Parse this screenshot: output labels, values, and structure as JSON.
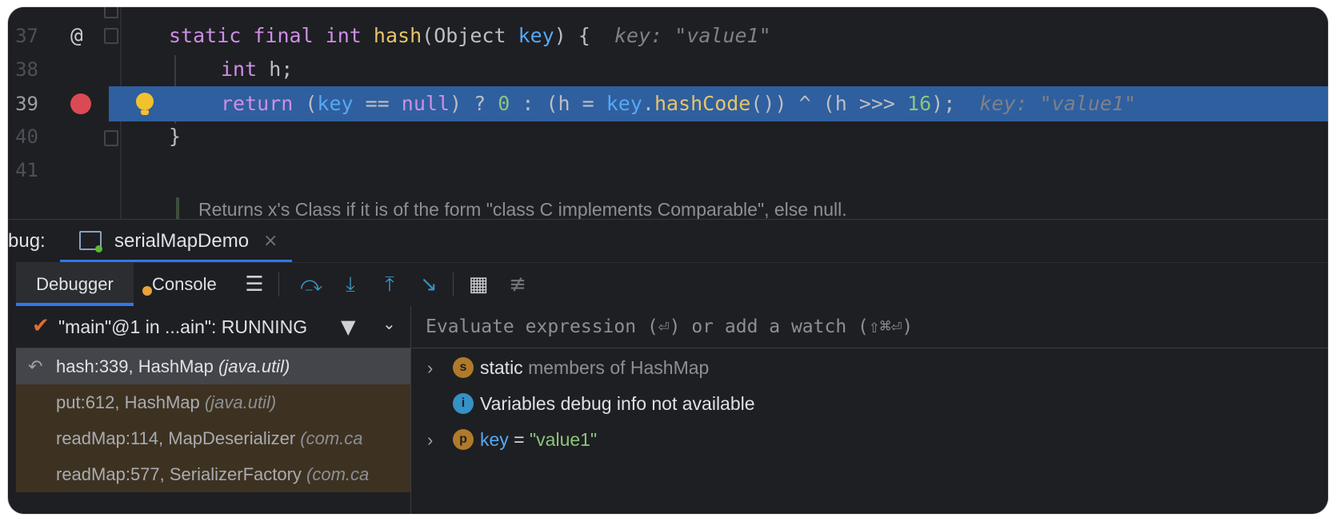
{
  "editor": {
    "lines": [
      {
        "num": "37",
        "gutter": "@"
      },
      {
        "num": "38"
      },
      {
        "num": "39"
      },
      {
        "num": "40"
      },
      {
        "num": "41"
      }
    ],
    "code": {
      "l37": {
        "kw1": "static",
        "kw2": "final",
        "kw3": "int",
        "fn": "hash",
        "p1": "(Object ",
        "arg": "key",
        "p2": ") {",
        "hint": "key: \"value1\""
      },
      "l38": {
        "kw": "int",
        "rest": " h;"
      },
      "l39": {
        "kw": "return",
        "p1": " (",
        "k1": "key",
        "p2": " == ",
        "nul": "null",
        "p3": ") ? ",
        "zero": "0",
        "p4": " : (h = ",
        "k2": "key",
        "dot": ".",
        "meth": "hashCode",
        "p5": "()) ^ (h >>> ",
        "sixteen": "16",
        "p6": ");",
        "hint": "key: \"value1\""
      },
      "l40": {
        "text": "}"
      }
    },
    "doc_text": "Returns x's Class if it is of the form \"class C implements Comparable\", else null."
  },
  "debug_bar": {
    "label": "bug:",
    "run_tab": "serialMapDemo",
    "close": "×"
  },
  "toolbar": {
    "tabs": [
      "Debugger",
      "Console"
    ],
    "icons": [
      "menu-icon",
      "step-over-icon",
      "step-into-icon",
      "step-out-icon",
      "run-to-cursor-icon",
      "evaluate-icon",
      "trace-icon"
    ]
  },
  "frames": {
    "thread": "\"main\"@1 in ...ain\": RUNNING",
    "items": [
      {
        "method": "hash:339, HashMap ",
        "pkg": "(java.util)"
      },
      {
        "method": "put:612, HashMap ",
        "pkg": "(java.util)"
      },
      {
        "method": "readMap:114, MapDeserializer ",
        "pkg": "(com.ca"
      },
      {
        "method": "readMap:577, SerializerFactory ",
        "pkg": "(com.ca"
      }
    ]
  },
  "variables": {
    "eval_placeholder": "Evaluate expression (⏎) or add a watch (⇧⌘⏎)",
    "rows": [
      {
        "badge": "s",
        "label": "static",
        "muted": " members of HashMap"
      },
      {
        "badge": "i",
        "label": "Variables debug info not available"
      },
      {
        "badge": "p",
        "name": "key",
        "eq": " = ",
        "value": "\"value1\""
      }
    ]
  },
  "colors": {
    "highlight_line": "#2f5f9e",
    "accent": "#3574f0",
    "frame_bg": "#3d3221",
    "breakpoint": "#db4a54"
  }
}
